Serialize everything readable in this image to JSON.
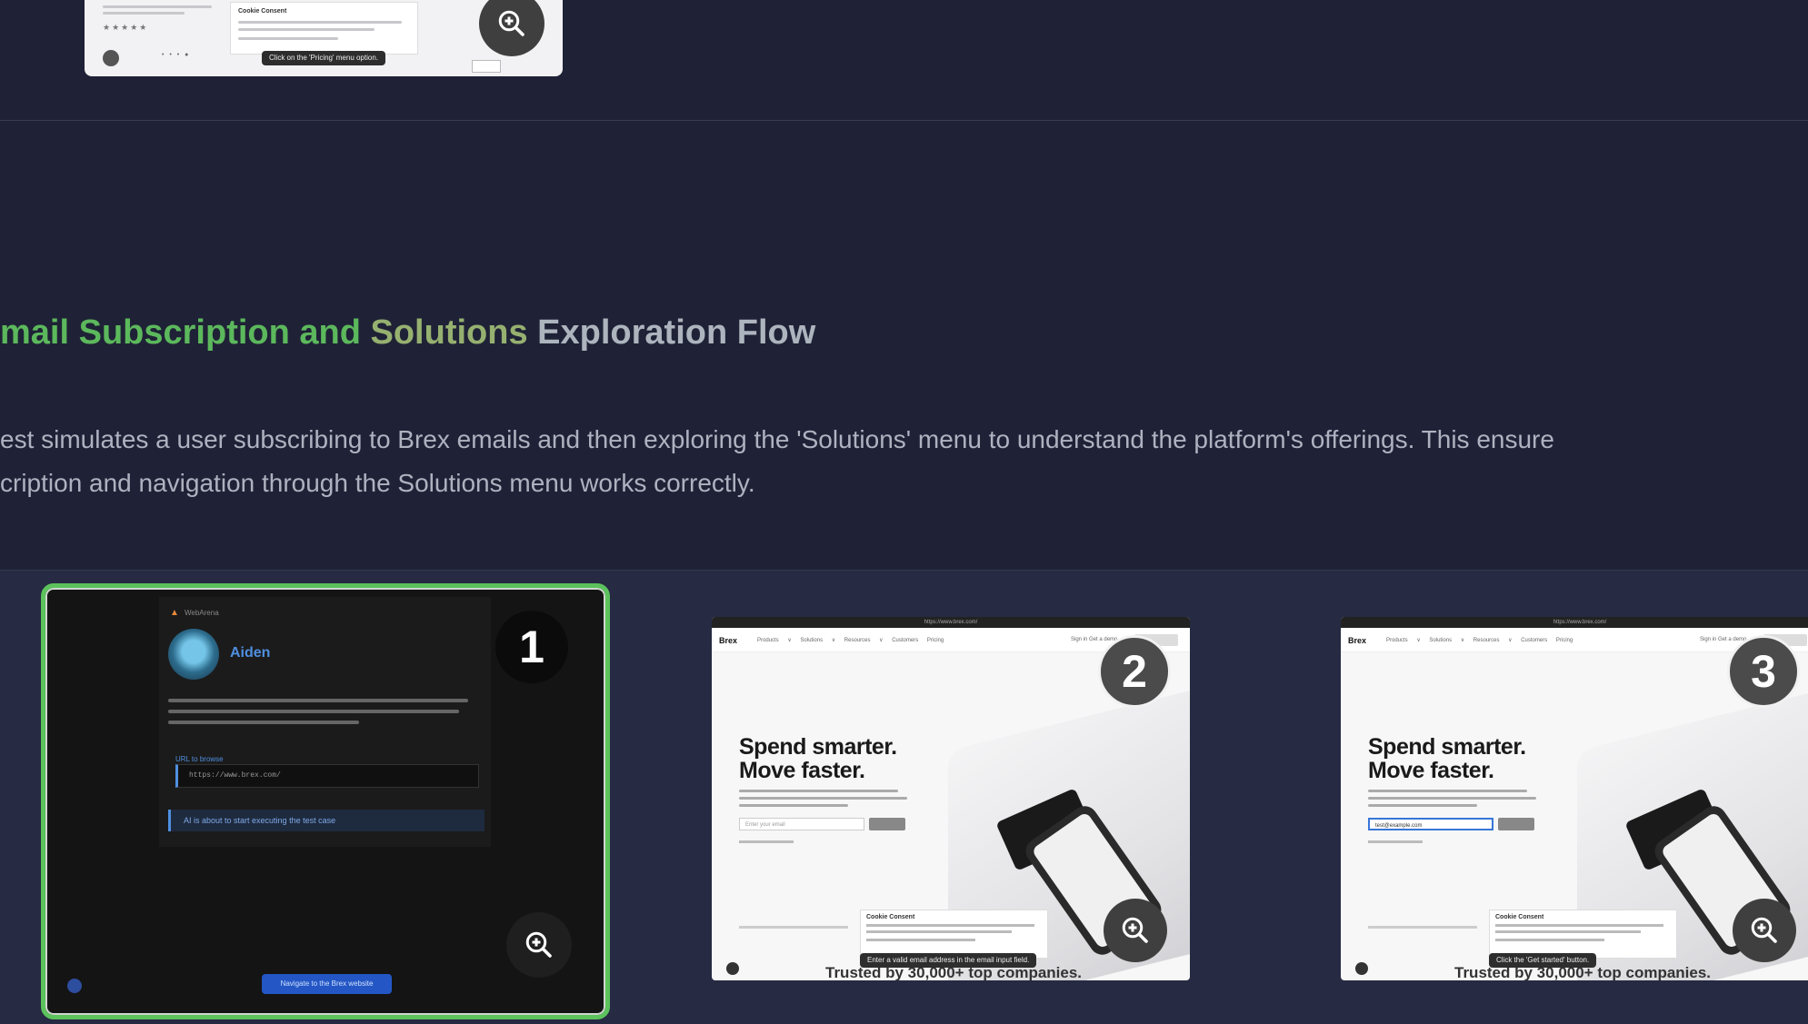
{
  "previous_card": {
    "tooltip": "Click on the 'Pricing' menu option.",
    "cookie_title": "Cookie Consent"
  },
  "section": {
    "title_part1": "mail Subscription and ",
    "title_part2": "Solutions ",
    "title_part3": "Exploration Flow",
    "description_line1": "est simulates a user subscribing to Brex emails and then exploring the 'Solutions' menu to understand the platform's offerings. This ensure",
    "description_line2": "cription and navigation through the Solutions menu works correctly."
  },
  "steps": [
    {
      "number": "1",
      "agent_name": "Aiden",
      "agent_brand": "WebArena",
      "field_label": "URL to browse",
      "field_value": "https://www.brex.com/",
      "status_text": "AI is about to start executing the test case",
      "action_button": "Navigate to the Brex website"
    },
    {
      "number": "2",
      "browser_url": "https://www.brex.com/",
      "logo": "Brex",
      "nav_items": "Products ∨ Solutions ∨ Resources ∨ Customers Pricing",
      "nav_right": "Sign in  Get a demo",
      "hero_line1": "Spend smarter.",
      "hero_line2": "Move faster.",
      "email_placeholder": "Enter your email",
      "cookie_title": "Cookie Consent",
      "tooltip": "Enter a valid email address in the email input field.",
      "trust_text": "Trusted by 30,000+ top companies."
    },
    {
      "number": "3",
      "browser_url": "https://www.brex.com/",
      "logo": "Brex",
      "nav_items": "Products ∨ Solutions ∨ Resources ∨ Customers Pricing",
      "nav_right": "Sign in  Get a demo",
      "hero_line1": "Spend smarter.",
      "hero_line2": "Move faster.",
      "email_value": "test@example.com",
      "cookie_title": "Cookie Consent",
      "tooltip": "Click the 'Get started' button.",
      "trust_text": "Trusted by 30,000+ top companies."
    }
  ],
  "colors": {
    "background": "#1f2236",
    "accent_green": "#5cb85c",
    "active_border": "#5cc25c",
    "link_blue": "#4f8fe0"
  },
  "icons": {
    "zoom": "zoom-in-icon",
    "info": "info-icon"
  }
}
